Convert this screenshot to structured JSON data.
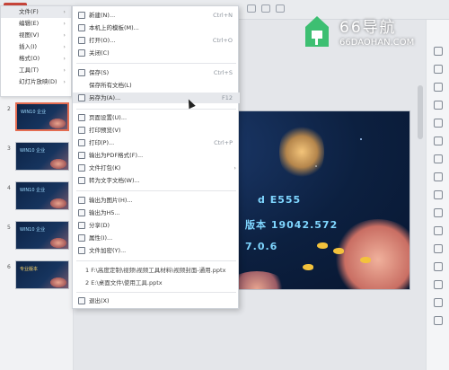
{
  "left_menu": [
    {
      "label": "文件(F)",
      "active": true
    },
    {
      "label": "编辑(E)"
    },
    {
      "label": "视图(V)"
    },
    {
      "label": "插入(I)"
    },
    {
      "label": "格式(O)"
    },
    {
      "label": "工具(T)"
    },
    {
      "label": "幻灯片放映(D)"
    }
  ],
  "file_menu": {
    "new": {
      "label": "新建(N)...",
      "shortcut": "Ctrl+N"
    },
    "template": {
      "label": "本机上的模板(M)..."
    },
    "open": {
      "label": "打开(O)...",
      "shortcut": "Ctrl+O"
    },
    "close": {
      "label": "关闭(C)"
    },
    "save": {
      "label": "保存(S)",
      "shortcut": "Ctrl+S"
    },
    "save_all": {
      "label": "保存所有文档(L)"
    },
    "save_as": {
      "label": "另存为(A)...",
      "shortcut": "F12"
    },
    "page_setup": {
      "label": "页面设置(U)..."
    },
    "print_preview": {
      "label": "打印预览(V)"
    },
    "print": {
      "label": "打印(P)...",
      "shortcut": "Ctrl+P"
    },
    "export_pdf": {
      "label": "输出为PDF格式(F)..."
    },
    "package": {
      "label": "文件打包(K)"
    },
    "to_word": {
      "label": "转为文字文档(W)..."
    },
    "export_image": {
      "label": "输出为图片(H)..."
    },
    "export_h5": {
      "label": "输出为H5..."
    },
    "share": {
      "label": "分享(D)"
    },
    "properties": {
      "label": "属性(I)..."
    },
    "encrypt": {
      "label": "文件加密(Y)..."
    },
    "recent_1": "1 F:\\高度定制\\视频\\视频工具材料\\视频封面-通用.pptx",
    "recent_2": "2 E:\\桌面文件\\使用工具.pptx",
    "exit": {
      "label": "退出(X)"
    }
  },
  "thumbs": [
    "2",
    "3",
    "4",
    "5",
    "6"
  ],
  "thumb_titles": [
    "WIN10 企业",
    "WIN10 企业",
    "WIN10 企业",
    "WIN10 企业",
    "专业版本"
  ],
  "slide": {
    "line1": "d E555",
    "line2": "版本 19042.572",
    "line3": "7.0.6"
  },
  "watermark": {
    "title": "66导航",
    "url": "66DAOHAN.COM"
  },
  "colors": {
    "accent": "#c7453a",
    "watermark_green": "#3dbf72"
  }
}
